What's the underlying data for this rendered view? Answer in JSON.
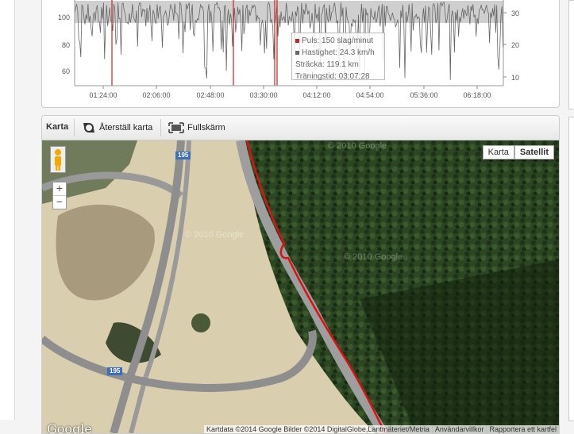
{
  "chart": {
    "y_left_ticks": [
      "100",
      "80",
      "60"
    ],
    "y_right_ticks": [
      "30",
      "20",
      "10"
    ],
    "x_ticks": [
      "01:24:00",
      "02:06:00",
      "02:48:00",
      "03:30:00",
      "04:12:00",
      "04:54:00",
      "05:36:00",
      "06:18:00"
    ],
    "tooltip": {
      "pulse": "Puls: 150 slag/minut",
      "speed": "Hastighet: 24.3 km/h",
      "distance": "Sträcka: 119.1 km",
      "time": "Träningstid: 03:07:28"
    },
    "colors": {
      "pulse": "#cc2222",
      "speed": "#666666"
    }
  },
  "map_panel": {
    "title": "Karta",
    "reset_label": "Återställ karta",
    "fullscreen_label": "Fullskärm",
    "map_type": {
      "map": "Karta",
      "satellite": "Satellit",
      "active": "satellite"
    },
    "zoom_in": "+",
    "zoom_out": "−",
    "road_shield_top": "195",
    "road_shield_bottom": "195",
    "watermark": "© 2010 Google",
    "logo": "Google",
    "attribution": {
      "data": "Kartdata ©2014 Google Bilder ©2014 DigitalGlobe,Lantmäteriet/Metria",
      "terms": "Användarvillkor",
      "report": "Rapportera ett kartfel"
    },
    "route_color": "#dd1111"
  }
}
